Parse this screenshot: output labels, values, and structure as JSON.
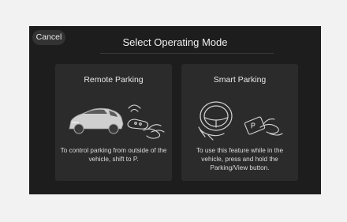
{
  "header": {
    "cancel_label": "Cancel",
    "title": "Select Operating Mode"
  },
  "options": [
    {
      "title": "Remote Parking",
      "icon": "car-and-key-fob-illustration",
      "description": "To control parking from outside of the vehicle, shift to P."
    },
    {
      "title": "Smart Parking",
      "icon": "steering-wheel-and-button-illustration",
      "description": "To use this feature while in the vehicle, press and hold the Parking/View button."
    }
  ]
}
